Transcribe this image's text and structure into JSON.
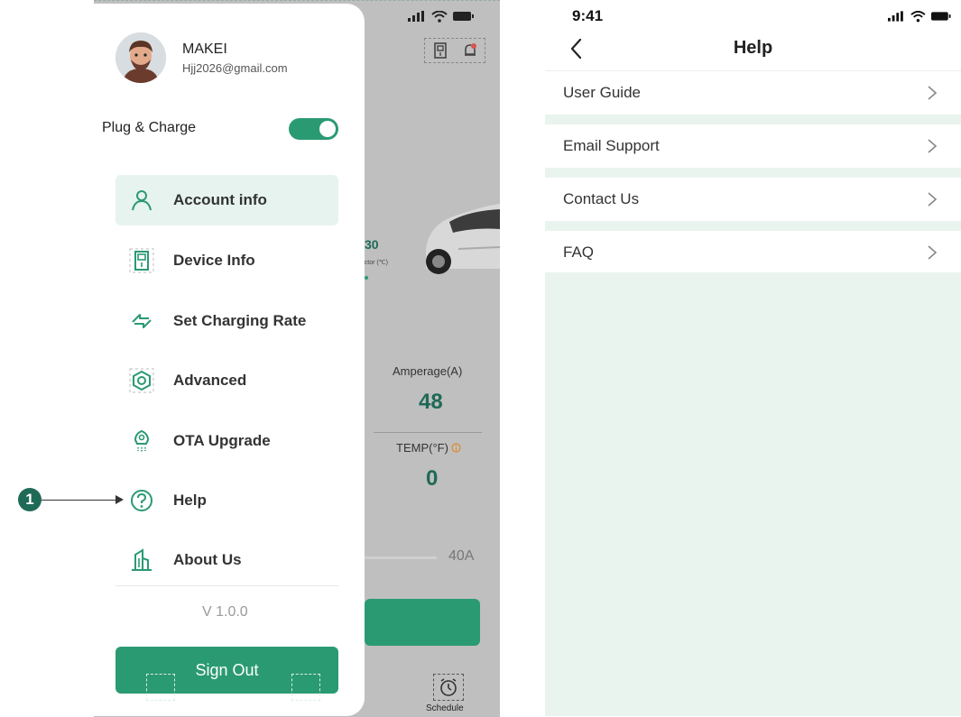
{
  "background_app": {
    "reading_value": "30",
    "reading_label": "nector (℃)",
    "amperage_label": "Amperage(A)",
    "amperage_value": "48",
    "temp_label": "TEMP(°F)",
    "temp_value": "0",
    "slider_max": "40A",
    "schedule_label": "Schedule"
  },
  "drawer": {
    "user_name": "MAKEI",
    "user_email": "Hjj2026@gmail.com",
    "plug_charge_label": "Plug & Charge",
    "plug_charge_enabled": true,
    "menu": [
      {
        "label": "Account info",
        "icon": "user-icon"
      },
      {
        "label": "Device Info",
        "icon": "charger-device-icon"
      },
      {
        "label": "Set Charging Rate",
        "icon": "swap-arrows-icon"
      },
      {
        "label": "Advanced",
        "icon": "hexagon-settings-icon"
      },
      {
        "label": "OTA Upgrade",
        "icon": "rocket-upgrade-icon"
      },
      {
        "label": "Help",
        "icon": "help-circle-icon"
      },
      {
        "label": "About Us",
        "icon": "building-icon"
      }
    ],
    "version": "V 1.0.0",
    "sign_out_label": "Sign Out"
  },
  "annotation": {
    "number": "1"
  },
  "help_screen": {
    "time": "9:41",
    "title": "Help",
    "items": [
      {
        "label": "User Guide"
      },
      {
        "label": "Email Support"
      },
      {
        "label": "Contact Us"
      },
      {
        "label": "FAQ"
      }
    ]
  },
  "colors": {
    "accent": "#2a9a72",
    "accent_dark": "#1f6a57",
    "active_bg": "#e7f3ee",
    "help_bg": "#eaf4ef"
  }
}
